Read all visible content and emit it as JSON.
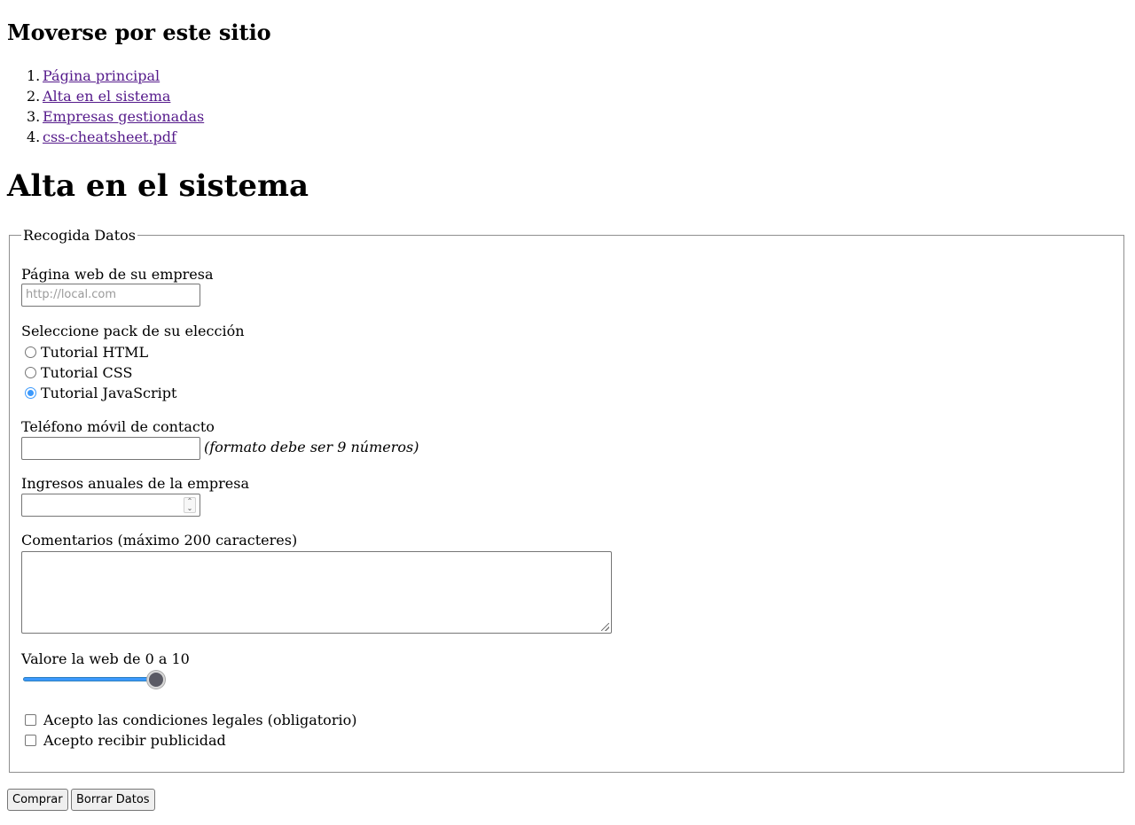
{
  "nav": {
    "heading": "Moverse por este sitio",
    "items": [
      {
        "num": "1.",
        "label": "Página principal"
      },
      {
        "num": "2.",
        "label": "Alta en el sistema"
      },
      {
        "num": "3.",
        "label": "Empresas gestionadas"
      },
      {
        "num": "4.",
        "label": "css-cheatsheet.pdf"
      }
    ]
  },
  "page": {
    "title": "Alta en el sistema"
  },
  "form": {
    "legend": "Recogida Datos",
    "website": {
      "label": "Página web de su empresa",
      "placeholder": "http://local.com",
      "value": ""
    },
    "pack": {
      "label": "Seleccione pack de su elección",
      "options": [
        {
          "label": "Tutorial HTML",
          "checked": false
        },
        {
          "label": "Tutorial CSS",
          "checked": false
        },
        {
          "label": "Tutorial JavaScript",
          "checked": true
        }
      ]
    },
    "phone": {
      "label": "Teléfono móvil de contacto",
      "value": "",
      "hint": "(formato debe ser 9 números)"
    },
    "income": {
      "label": "Ingresos anuales de la empresa",
      "value": ""
    },
    "comments": {
      "label": "Comentarios (máximo 200 caracteres)",
      "value": ""
    },
    "rating": {
      "label": "Valore la web de 0 a 10",
      "min": 0,
      "max": 10,
      "value": 10
    },
    "checkboxes": [
      {
        "label": "Acepto las condiciones legales (obligatorio)",
        "checked": false
      },
      {
        "label": "Acepto recibir publicidad",
        "checked": false
      }
    ]
  },
  "buttons": {
    "submit": "Comprar",
    "reset": "Borrar Datos"
  },
  "colors": {
    "link_visited": "#551a8b",
    "accent": "#3b99fc",
    "border": "#767676"
  }
}
